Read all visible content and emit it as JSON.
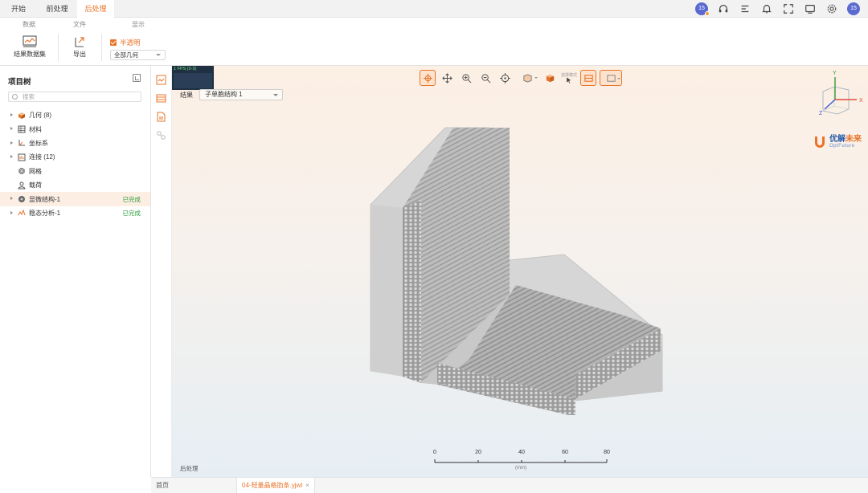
{
  "menubar": {
    "tabs": [
      {
        "label": "开始"
      },
      {
        "label": "前处理"
      },
      {
        "label": "后处理"
      }
    ],
    "active_tab": "后处理",
    "icons": [
      "user-avatar-icon",
      "headset-icon",
      "list-icon",
      "bell-icon",
      "fullscreen-icon",
      "screenshot-icon",
      "gear-icon",
      "user-avatar-icon"
    ],
    "avatar_text": "15"
  },
  "ribbon": {
    "groups": [
      "数据",
      "文件",
      "显示"
    ],
    "buttons": {
      "result_data": "结果数据集",
      "export": "导出"
    },
    "checkbox_label": "半透明",
    "select_value": "全部几何"
  },
  "project_tree": {
    "title": "项目树",
    "search_placeholder": "搜索",
    "items": [
      {
        "label": "几何 (8)",
        "icon": "cube-icon",
        "has_arrow": true,
        "status": ""
      },
      {
        "label": "材料",
        "icon": "material-icon",
        "has_arrow": true,
        "status": ""
      },
      {
        "label": "坐标系",
        "icon": "axis-icon",
        "has_arrow": true,
        "status": ""
      },
      {
        "label": "连接 (12)",
        "icon": "link-icon",
        "has_arrow": true,
        "status": ""
      },
      {
        "label": "网格",
        "icon": "mesh-icon",
        "has_arrow": false,
        "status": ""
      },
      {
        "label": "载荷",
        "icon": "load-icon",
        "has_arrow": false,
        "status": ""
      },
      {
        "label": "显微结构-1",
        "icon": "microstructure-icon",
        "has_arrow": true,
        "status": "已完成",
        "selected": true
      },
      {
        "label": "稳态分析-1",
        "icon": "analysis-icon",
        "has_arrow": true,
        "status": "已完成"
      }
    ]
  },
  "viewport": {
    "fps_text": "1 FPS (0-3)",
    "result_label": "结果",
    "result_select": "子单胞结构 1",
    "toolbar_small_label": "选择模式",
    "logo": {
      "name_a": "优解",
      "name_b": "未来",
      "sub": "OptFuture"
    },
    "axes": {
      "x": "X",
      "y": "Y",
      "z": "Z"
    },
    "scale": {
      "ticks": [
        "0",
        "20",
        "40",
        "60",
        "80"
      ],
      "unit": "(mm)"
    },
    "bottom_label": "后处理"
  },
  "bottom_tabs": {
    "home": "首页",
    "file": "04-轻量晶格肋条.yjwl",
    "close": "×"
  },
  "colors": {
    "accent": "#e8742a",
    "success": "#2e9c3a"
  }
}
